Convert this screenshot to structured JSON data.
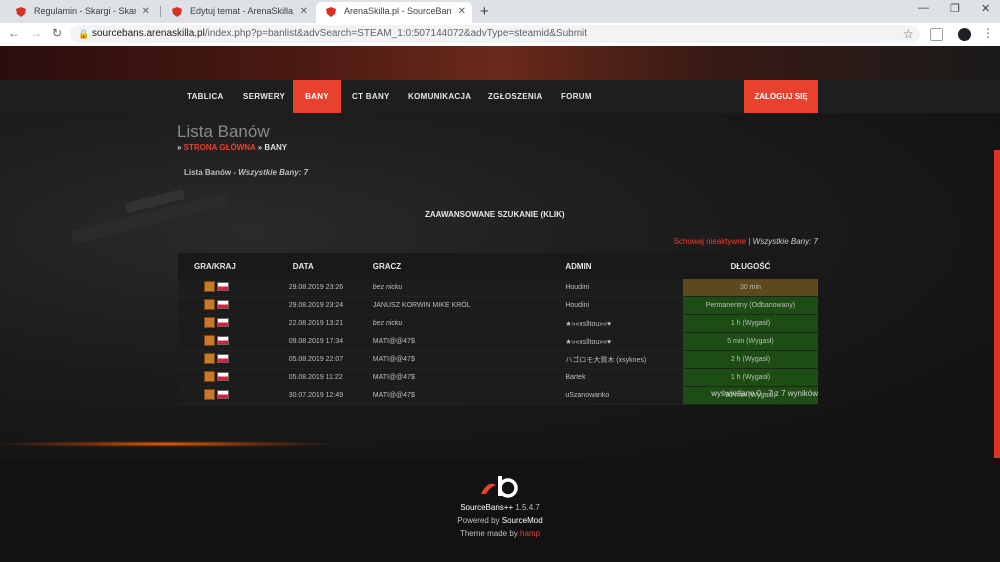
{
  "browser": {
    "tabs": [
      {
        "title": "Regulamin - Skargi - Skargi - Are",
        "active": false
      },
      {
        "title": "Edytuj temat - ArenaSkilla.pl",
        "active": false
      },
      {
        "title": "ArenaSkilla.pl - SourceBans",
        "active": true
      }
    ],
    "url_host": "sourcebans.arenaskilla.pl",
    "url_path": "/index.php?p=banlist&advSearch=STEAM_1:0:507144072&advType=steamid&Submit"
  },
  "nav": {
    "items": [
      "TABLICA",
      "SERWERY",
      "BANY",
      "CT BANY",
      "KOMUNIKACJA",
      "ZGŁOSZENIA",
      "FORUM"
    ],
    "active": "BANY",
    "login": "ZALOGUJ SIĘ"
  },
  "page": {
    "title": "Lista Banów",
    "breadcrumb_home": "STRONA GŁÓWNA",
    "breadcrumb_current": "BANY",
    "subhead_prefix": "Lista Banów - ",
    "subhead_count": "Wszystkie Bany: 7",
    "advanced_search": "ZAAWANSOWANE SZUKANIE (KLIK)",
    "show_inactive": "Schowaj nieaktywne",
    "show_sep": " | ",
    "total": "Wszystkie Bany: 7",
    "pagination": "wyświetlane 0 - 7 z 7 wyników"
  },
  "table": {
    "headers": [
      "GRA/KRAJ",
      "DATA",
      "GRACZ",
      "ADMIN",
      "DŁUGOŚĆ"
    ],
    "rows": [
      {
        "date": "29.08.2019 23:26",
        "player": "bez nicku",
        "player_italic": true,
        "admin": "Houdini",
        "length": "30 min",
        "status": "active"
      },
      {
        "date": "29.08.2019 23:24",
        "player": "JANUSZ KORWIN MIKE KRÓL",
        "player_italic": false,
        "admin": "Houdini",
        "length": "Permanentny (Odbanowany)",
        "status": "unbanned"
      },
      {
        "date": "22.08.2019 13:21",
        "player": "bez nicku",
        "player_italic": true,
        "admin": "★»«xslltou»«♥",
        "length": "1 h (Wygasł)",
        "status": "expired"
      },
      {
        "date": "09.08.2019 17:34",
        "player": "MATI@@47$",
        "player_italic": false,
        "admin": "★»«xslltou»«♥",
        "length": "5 min (Wygasł)",
        "status": "expired"
      },
      {
        "date": "05.08.2019 22:07",
        "player": "MATI@@47$",
        "player_italic": false,
        "admin": "ハゴロモ大賀木 (xsyknes)",
        "length": "2 h (Wygasł)",
        "status": "expired"
      },
      {
        "date": "05.08.2019 11:22",
        "player": "MATI@@47$",
        "player_italic": false,
        "admin": "Bartek",
        "length": "1 h (Wygasł)",
        "status": "expired"
      },
      {
        "date": "30.07.2019 12:49",
        "player": "MATI@@47$",
        "player_italic": false,
        "admin": "uSzanowanko",
        "length": "30 min (Wygasł)",
        "status": "expired"
      }
    ]
  },
  "footer": {
    "product": "SourceBans++",
    "version": " 1.5.4.7",
    "powered_prefix": "Powered by ",
    "powered_by": "SourceMod",
    "theme_prefix": "Theme made by ",
    "theme_author": "hamp"
  },
  "colors": {
    "accent": "#e8412e",
    "active_ban": "#5c4a1e",
    "expired_ban": "#1d4d14"
  }
}
